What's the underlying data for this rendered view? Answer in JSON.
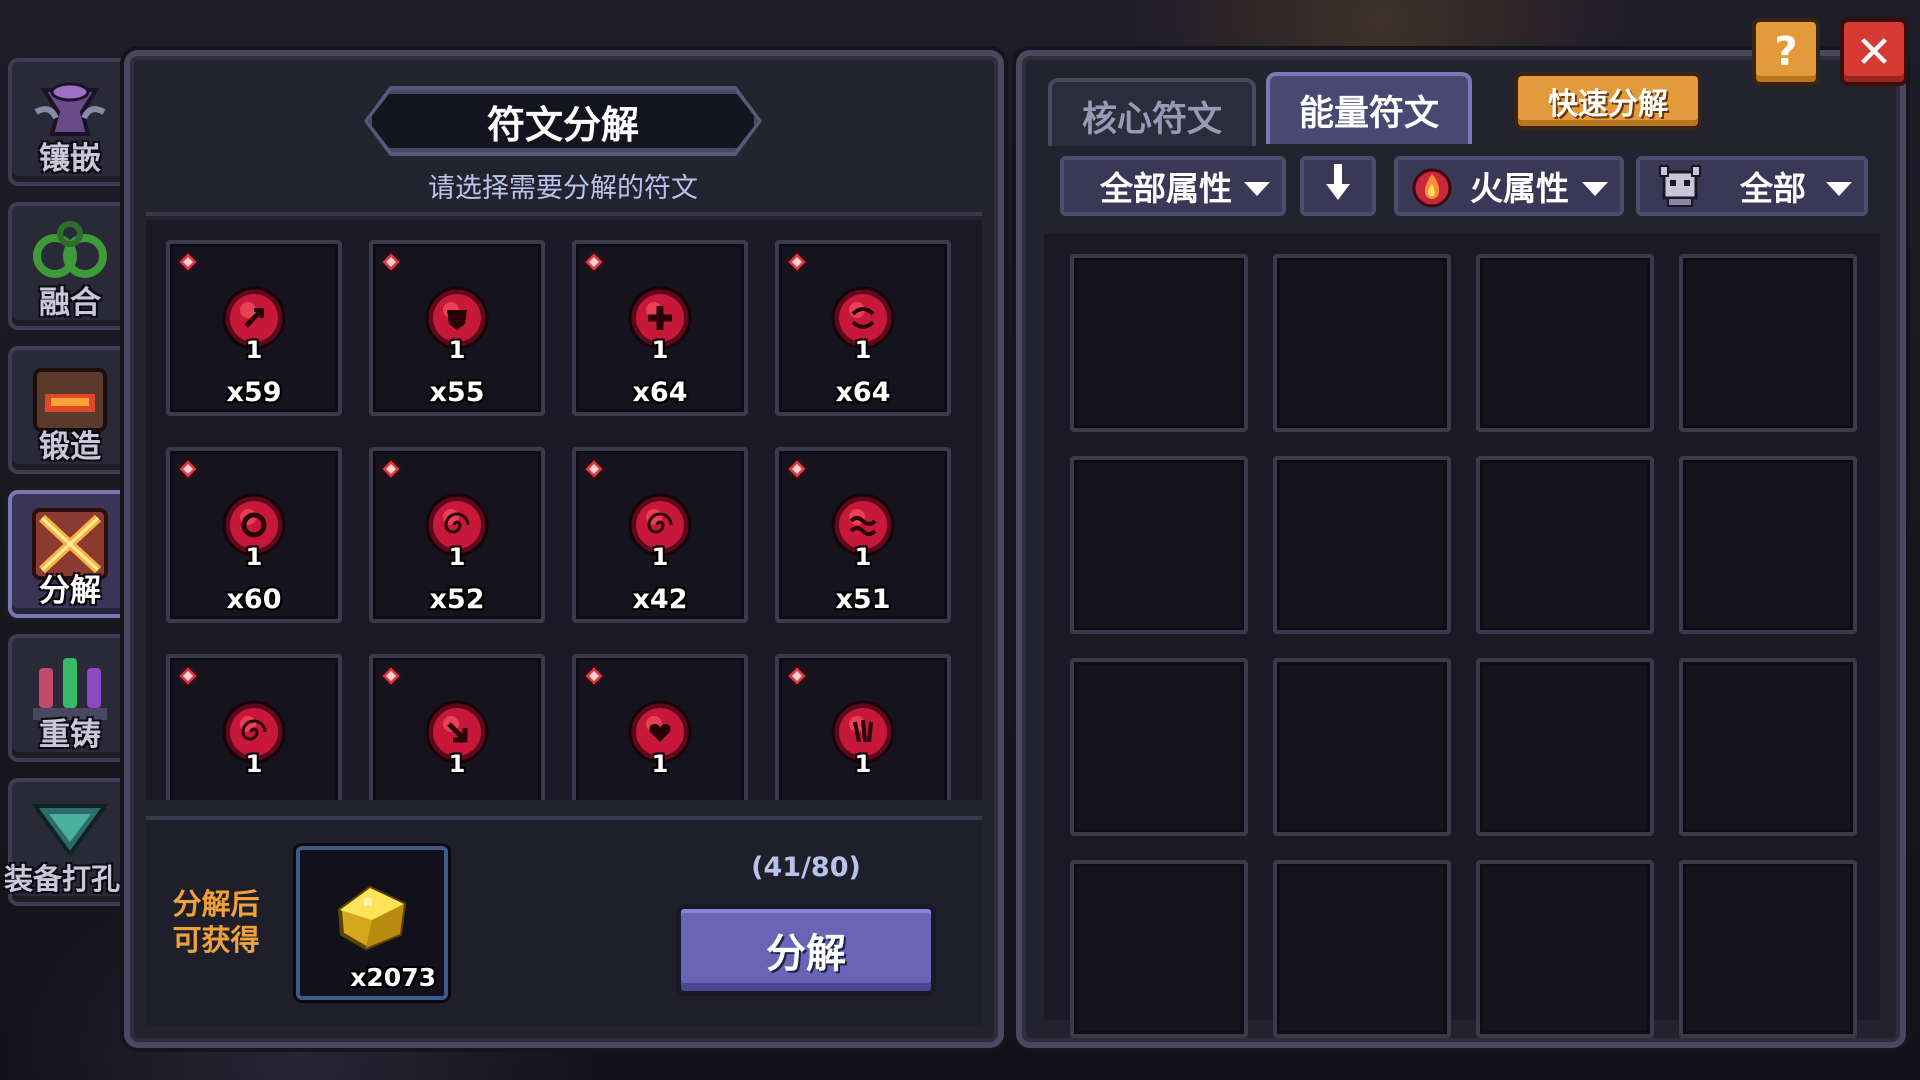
{
  "sidebar": {
    "items": [
      {
        "label": "镶嵌",
        "icon": "inlay-icon",
        "active": false
      },
      {
        "label": "融合",
        "icon": "fusion-icon",
        "active": false
      },
      {
        "label": "锻造",
        "icon": "forge-icon",
        "active": false
      },
      {
        "label": "分解",
        "icon": "decompose-icon",
        "active": true
      },
      {
        "label": "重铸",
        "icon": "recast-icon",
        "active": false
      },
      {
        "label": "装备打孔",
        "icon": "socket-drill-icon",
        "active": false
      }
    ]
  },
  "decompose_panel": {
    "title": "符文分解",
    "subtitle": "请选择需要分解的符文",
    "runes": [
      {
        "level": "1",
        "count": "x59",
        "icon": "rune-slash-icon"
      },
      {
        "level": "1",
        "count": "x55",
        "icon": "rune-shield-icon"
      },
      {
        "level": "1",
        "count": "x64",
        "icon": "rune-cross-icon"
      },
      {
        "level": "1",
        "count": "x64",
        "icon": "rune-swirl-icon"
      },
      {
        "level": "1",
        "count": "x60",
        "icon": "rune-ring-icon"
      },
      {
        "level": "1",
        "count": "x52",
        "icon": "rune-spiral-icon"
      },
      {
        "level": "1",
        "count": "x42",
        "icon": "rune-spiral-icon"
      },
      {
        "level": "1",
        "count": "x51",
        "icon": "rune-wave-icon"
      },
      {
        "level": "1",
        "count": "",
        "icon": "rune-spiral-icon"
      },
      {
        "level": "1",
        "count": "",
        "icon": "rune-arrow-icon"
      },
      {
        "level": "1",
        "count": "",
        "icon": "rune-heart-icon"
      },
      {
        "level": "1",
        "count": "",
        "icon": "rune-claw-icon"
      }
    ],
    "reward_label_line1": "分解后",
    "reward_label_line2": "可获得",
    "reward_count": "x2073",
    "reward_icon": "gold-ore-icon",
    "capacity": "(41/80)",
    "decompose_button": "分解"
  },
  "right_panel": {
    "tabs": [
      {
        "label": "核心符文",
        "active": false
      },
      {
        "label": "能量符文",
        "active": true
      }
    ],
    "quick_decompose": "快速分解",
    "filters": {
      "attribute": "全部属性",
      "element": "火属性",
      "category": "全部"
    },
    "help_label": "?",
    "close_label": "✕",
    "inventory_slots": 16
  },
  "colors": {
    "accent_orange": "#e39a3a",
    "close_red": "#d63a35",
    "button_purple": "#6a64b8",
    "rune_red": "#c8183a",
    "reward_label": "#f0a23a"
  }
}
